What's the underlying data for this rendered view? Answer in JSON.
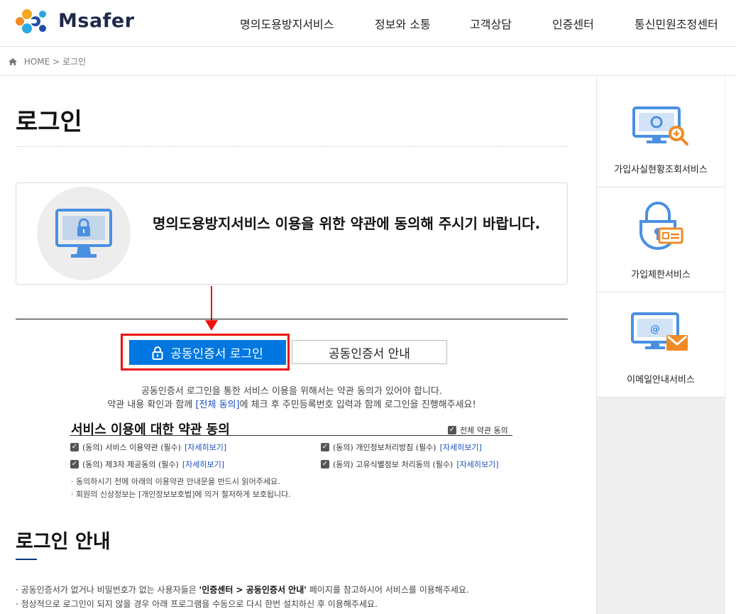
{
  "header": {
    "logo_text": "Msafer",
    "nav": [
      "명의도용방지서비스",
      "정보와 소통",
      "고객상담",
      "인증센터",
      "통신민원조정센터"
    ]
  },
  "breadcrumb": {
    "home": "HOME",
    "separator": ">",
    "current": "로그인"
  },
  "page_title": "로그인",
  "notice": {
    "text": "명의도용방지서비스 이용을 위한 약관에 동의해 주시기 바랍니다."
  },
  "buttons": {
    "login": "공동인증서 로그인",
    "guide": "공동인증서 안내"
  },
  "info": {
    "line1": "공동인증서 로그인을 통한 서비스 이용을 위해서는 약관 동의가 있어야 합니다.",
    "line2_pre": "약관 내용 확인과 함께 ",
    "line2_link": "[전체 동의]",
    "line2_post": "에 체크 후 주민등록번호 입력과 함께 로그인을 진행해주세요!"
  },
  "terms": {
    "title": "서비스 이용에 대한 약관 동의",
    "all_label": "전체 약관 동의",
    "detail_link": "[자세히보기]",
    "items": [
      {
        "label": "(동의) 서비스 이용약관 (필수)",
        "checked": true
      },
      {
        "label": "(동의) 개인정보처리방침 (필수)",
        "checked": true
      },
      {
        "label": "(동의) 제3자 제공동의 (필수)",
        "checked": true
      },
      {
        "label": "(동의) 고유식별정보 처리동의 (필수)",
        "checked": true
      }
    ],
    "notes": [
      "· 동의하시기 전에 아래의 이용약관 안내문을 반드시 읽어주세요.",
      "· 회원의 신상정보는 [개인정보보호법]에 의거 철저하게 보호됩니다."
    ]
  },
  "guide": {
    "title": "로그인 안내",
    "line1_pre": "· 공동인증서가 없거나 비밀번호가 없는 사용자들은 ",
    "line1_bold": "'인증센터 > 공동인증서 안내'",
    "line1_post": " 페이지를 참고하시어 서비스를 이용해주세요.",
    "line2": "· 정상적으로 로그인이 되지 않을 경우 아래 프로그램을 수동으로 다시 한번 설치하신 후 이용해주세요."
  },
  "sidebar": {
    "items": [
      {
        "label": "가입사실현황조회서비스",
        "icon": "monitor-search-icon"
      },
      {
        "label": "가입제한서비스",
        "icon": "lock-card-icon"
      },
      {
        "label": "이메일안내서비스",
        "icon": "monitor-email-icon"
      }
    ]
  },
  "colors": {
    "primary": "#0077e0",
    "highlight": "#e11111",
    "accent_orange": "#f08a24",
    "icon_blue": "#4a90e2"
  }
}
